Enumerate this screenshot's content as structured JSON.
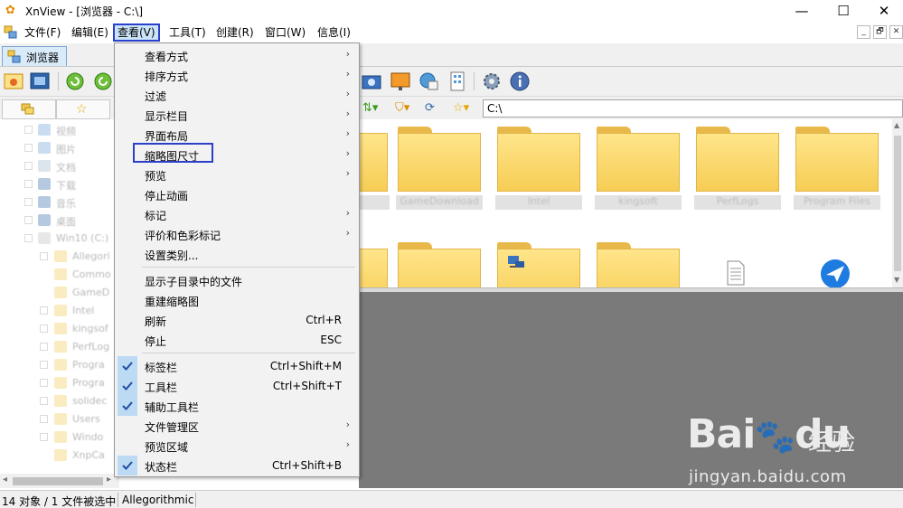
{
  "window": {
    "title": "XnView - [浏览器 - C:\\]",
    "minimize": "—",
    "maximize": "☐",
    "close": "✕"
  },
  "menubar": {
    "items": [
      {
        "label": "文件(F)"
      },
      {
        "label": "编辑(E)"
      },
      {
        "label": "查看(V)",
        "active": true
      },
      {
        "label": "工具(T)"
      },
      {
        "label": "创建(R)"
      },
      {
        "label": "窗口(W)"
      },
      {
        "label": "信息(I)"
      }
    ],
    "mdi": [
      "_",
      "🗗",
      "✕"
    ]
  },
  "tabs": [
    {
      "label": "浏览器"
    }
  ],
  "address": {
    "value": "C:\\"
  },
  "view_menu": {
    "items": [
      {
        "label": "查看方式",
        "submenu": true
      },
      {
        "label": "排序方式",
        "submenu": true
      },
      {
        "label": "过滤",
        "submenu": true
      },
      {
        "label": "显示栏目",
        "submenu": true
      },
      {
        "label": "界面布局",
        "submenu": true
      },
      {
        "label": "缩略图尺寸",
        "submenu": true,
        "highlighted": true
      },
      {
        "label": "预览",
        "submenu": true
      },
      {
        "label": "停止动画"
      },
      {
        "label": "标记",
        "submenu": true
      },
      {
        "label": "评价和色彩标记",
        "submenu": true
      },
      {
        "label": "设置类别..."
      },
      {
        "label": "显示子目录中的文件"
      },
      {
        "label": "重建缩略图"
      },
      {
        "label": "刷新",
        "shortcut": "Ctrl+R"
      },
      {
        "label": "停止",
        "shortcut": "ESC"
      },
      {
        "label": "标签栏",
        "shortcut": "Ctrl+Shift+M",
        "checked": true
      },
      {
        "label": "工具栏",
        "shortcut": "Ctrl+Shift+T",
        "checked": true
      },
      {
        "label": "辅助工具栏",
        "checked": true
      },
      {
        "label": "文件管理区",
        "submenu": true
      },
      {
        "label": "预览区域",
        "submenu": true
      },
      {
        "label": "状态栏",
        "shortcut": "Ctrl+Shift+B",
        "checked": true
      }
    ],
    "submenu_arrow": "›"
  },
  "tree": {
    "items": [
      "视频",
      "图片",
      "文档",
      "下载",
      "音乐",
      "桌面",
      "Win10 (C:)",
      "Allegori",
      "Commo",
      "GameD",
      "Intel",
      "kingsof",
      "PerfLog",
      "Progra",
      "Progra",
      "solidec",
      "Users",
      "Windo",
      "XnpCa"
    ]
  },
  "thumbnails": {
    "row1_labels": [
      "...",
      "GameDownload",
      "Intel",
      "kingsoft",
      "PerfLogs",
      "Program Files"
    ]
  },
  "status": {
    "selection": "14 对象 / 1 文件被选中",
    "name": "Allegorithmic"
  },
  "watermark": {
    "brand": "Bai",
    "brand_suffix": "du",
    "cn": "经验",
    "url": "jingyan.baidu.com"
  },
  "colors": {
    "menu_highlight_border": "#2b3fc9",
    "check_bg": "#bcdaf4",
    "folder_yellow": "#f6cd55",
    "preview_bg": "#7a7a7a"
  }
}
